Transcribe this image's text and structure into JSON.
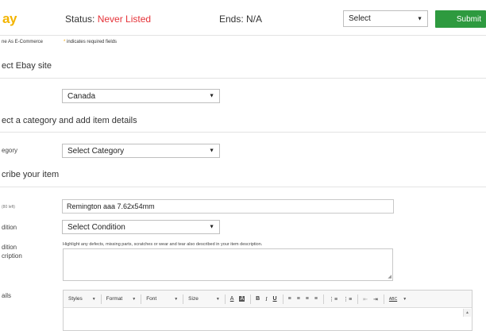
{
  "header": {
    "logo_text": "ay",
    "status_label": "Status:",
    "status_value": "Never Listed",
    "ends_text": "Ends: N/A",
    "action_select": "Select",
    "submit_label": "Submit",
    "colors": {
      "status": "#e53238",
      "submit": "#2e9a3f",
      "logo": "#f3b400"
    }
  },
  "subheader": {
    "same_as_text": "ne As E-Commerce",
    "required_star": "*",
    "required_text": "indicates required fields"
  },
  "sections": {
    "site_title": "ect Ebay site",
    "category_title": "ect a category and add item details",
    "describe_title": "cribe your item"
  },
  "fields": {
    "site_value": "Canada",
    "category_label": "egory",
    "category_value": "Select Category",
    "title_label": "(80 left)",
    "title_value": "Remington aaa 7.62x54mm",
    "condition_label": "dition",
    "condition_value": "Select Condition",
    "cond_desc_label_1": "dition",
    "cond_desc_label_2": "cription",
    "cond_desc_hint": "Highlight any defects, missing parts, scratches or wear and tear also described in your item description.",
    "details_label": "ails"
  },
  "editor": {
    "styles": "Styles",
    "format": "Format",
    "font": "Font",
    "size": "Size",
    "text_color": "A",
    "bg_color": "A",
    "bold": "B",
    "italic": "I",
    "underline": "U",
    "align_left": "≡",
    "align_center": "≡",
    "align_right": "≡",
    "justify": "≡",
    "ordered_list": "⋮≡",
    "bullet_list": "⋮≡",
    "outdent": "⇤",
    "indent": "⇥",
    "spellcheck": "ABC"
  }
}
